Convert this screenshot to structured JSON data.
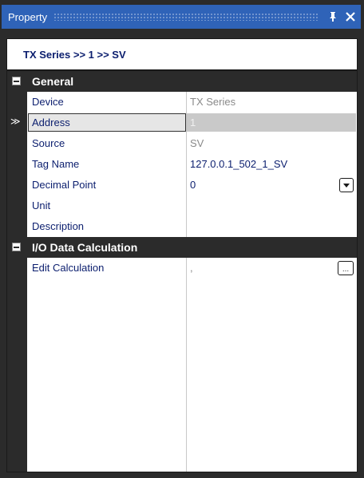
{
  "window": {
    "title": "Property",
    "pin_icon": "pin-icon",
    "close_icon": "close-icon"
  },
  "breadcrumb": "TX Series >> 1 >> SV",
  "categories": [
    {
      "label": "General",
      "properties": [
        {
          "name": "Device",
          "value": "TX Series"
        },
        {
          "name": "Address",
          "value": "1"
        },
        {
          "name": "Source",
          "value": "SV"
        },
        {
          "name": "Tag Name",
          "value": "127.0.0.1_502_1_SV"
        },
        {
          "name": "Decimal Point",
          "value": "0"
        },
        {
          "name": "Unit",
          "value": ""
        },
        {
          "name": "Description",
          "value": ""
        }
      ]
    },
    {
      "label": "I/O Data Calculation",
      "properties": [
        {
          "name": "Edit Calculation",
          "value": ","
        }
      ]
    }
  ],
  "selected_marker": "≫",
  "colors": {
    "titlebar": "#2f63b8",
    "frame": "#2b2b2b",
    "text": "#0b1e6e"
  }
}
